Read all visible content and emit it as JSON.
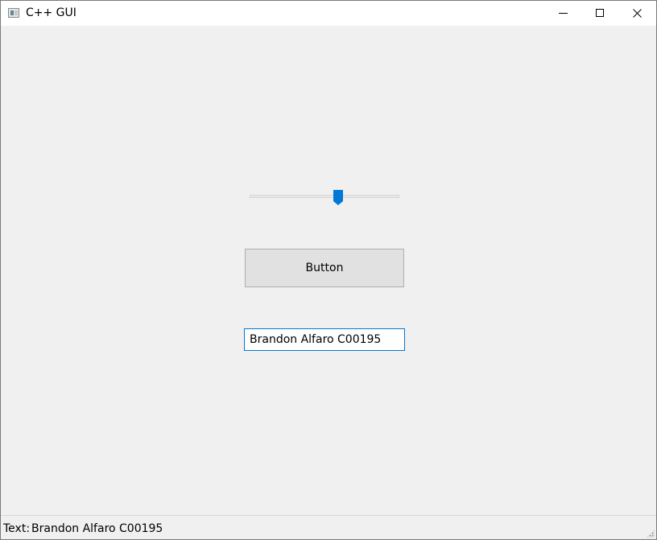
{
  "window": {
    "title": "C++ GUI",
    "icon": "app-window-icon",
    "controls": {
      "minimize": "minimize-icon",
      "maximize": "maximize-icon",
      "close": "close-icon"
    }
  },
  "slider": {
    "value_fraction": 0.59,
    "accent": "#0078d7"
  },
  "button": {
    "label": "Button"
  },
  "textbox": {
    "value": "Brandon Alfaro C00195"
  },
  "status": {
    "prefix": "Text:",
    "value": "Brandon Alfaro C00195"
  }
}
